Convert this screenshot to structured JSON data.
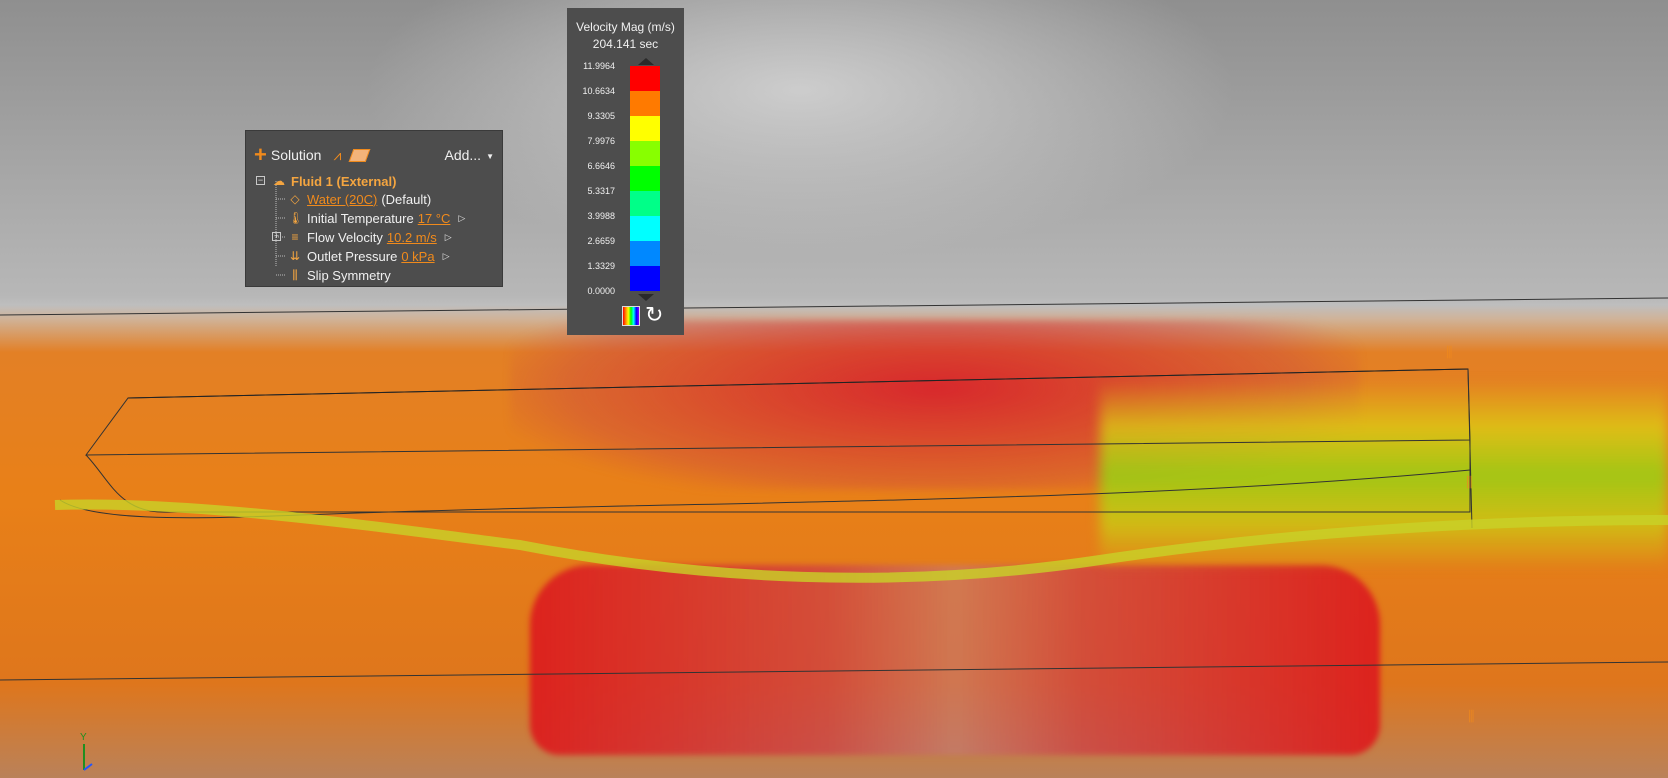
{
  "solution_panel": {
    "title": "Solution",
    "add_label": "Add...",
    "tree": {
      "fluid": "Fluid 1 (External)",
      "material_link": "Water (20C)",
      "material_suffix": "(Default)",
      "temperature_label": "Initial Temperature",
      "temperature_value": "17 °C",
      "velocity_label": "Flow Velocity",
      "velocity_value": "10.2 m/s",
      "pressure_label": "Outlet Pressure",
      "pressure_value": "0 kPa",
      "symmetry_label": "Slip Symmetry"
    }
  },
  "legend": {
    "title": "Velocity Mag (m/s)",
    "time": "204.141 sec",
    "ticks": [
      "11.9964",
      "10.6634",
      "9.3305",
      "7.9976",
      "6.6646",
      "5.3317",
      "3.9988",
      "2.6659",
      "1.3329",
      "0.0000"
    ],
    "colors": [
      "#ff0000",
      "#ff7a00",
      "#ffff00",
      "#88ff00",
      "#00ff00",
      "#00ff88",
      "#00ffff",
      "#0088ff",
      "#0000ff"
    ]
  },
  "axis": {
    "y_label": "Y"
  },
  "colors": {
    "accent": "#f08a1c",
    "panel_bg": "#4d4d4d"
  }
}
